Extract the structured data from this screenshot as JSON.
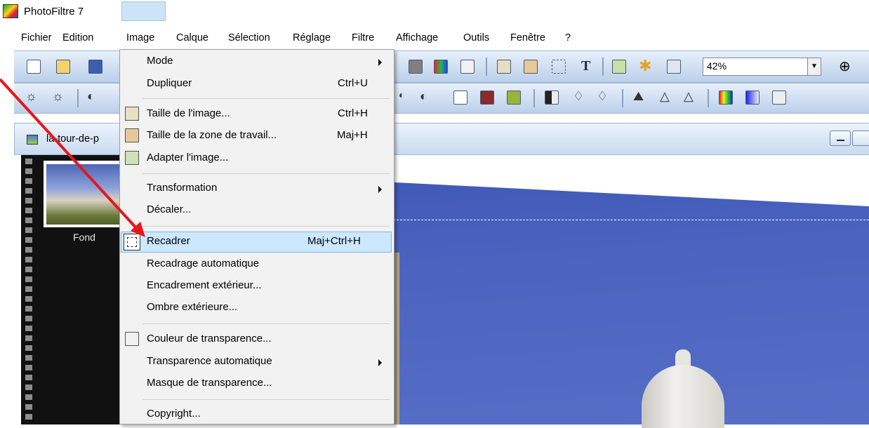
{
  "app": {
    "title": "PhotoFiltre 7",
    "logo_icon": "photofiltre-logo-icon"
  },
  "menubar": {
    "items": [
      "Fichier",
      "Edition",
      "Image",
      "Calque",
      "Sélection",
      "Réglage",
      "Filtre",
      "Affichage",
      "Outils",
      "Fenêtre",
      "?"
    ],
    "active": "Image"
  },
  "toolbar": {
    "zoom_value": "42%"
  },
  "document": {
    "title": "la-tour-de-p",
    "layer_label": "Fond"
  },
  "image_menu": {
    "items": [
      {
        "label": "Mode",
        "shortcut": "",
        "submenu": true
      },
      {
        "label": "Dupliquer",
        "shortcut": "Ctrl+U"
      },
      {
        "label": "Taille de l'image...",
        "shortcut": "Ctrl+H",
        "icon": "image-size-icon"
      },
      {
        "label": "Taille de la zone de travail...",
        "shortcut": "Maj+H",
        "icon": "canvas-size-icon"
      },
      {
        "label": "Adapter l'image...",
        "shortcut": "",
        "icon": "fit-image-icon"
      },
      {
        "label": "Transformation",
        "shortcut": "",
        "submenu": true
      },
      {
        "label": "Décaler...",
        "shortcut": ""
      },
      {
        "label": "Recadrer",
        "shortcut": "Maj+Ctrl+H",
        "icon": "crop-icon",
        "highlighted": true
      },
      {
        "label": "Recadrage automatique",
        "shortcut": ""
      },
      {
        "label": "Encadrement extérieur...",
        "shortcut": ""
      },
      {
        "label": "Ombre extérieure...",
        "shortcut": ""
      },
      {
        "label": "Couleur de transparence...",
        "shortcut": "",
        "icon": "transparency-color-icon"
      },
      {
        "label": "Transparence automatique",
        "shortcut": "",
        "submenu": true
      },
      {
        "label": "Masque de transparence...",
        "shortcut": ""
      },
      {
        "label": "Copyright...",
        "shortcut": ""
      }
    ]
  },
  "colors": {
    "menu_highlight": "#cce8ff",
    "menu_active": "#cce4f7",
    "annotation_arrow": "#e8151b",
    "toolbar": "#bcd0ea"
  }
}
